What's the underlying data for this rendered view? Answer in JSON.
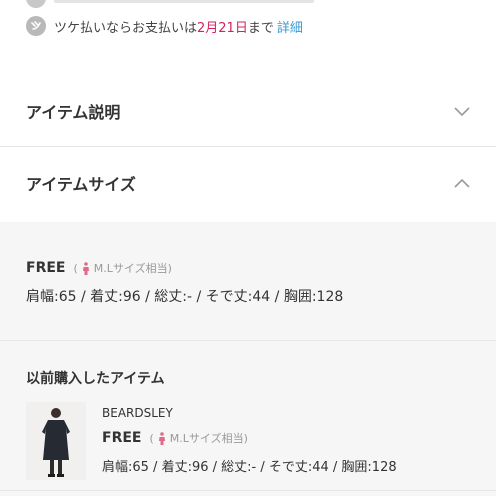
{
  "payment": {
    "text_before": "ツケ払いならお支払いは",
    "date": "2月21日",
    "text_after": "まで",
    "link": "詳細",
    "icon": "tsuke-payment-icon"
  },
  "sections": {
    "description": {
      "title": "アイテム説明",
      "chevron": "chevron-down"
    },
    "size": {
      "title": "アイテムサイズ",
      "chevron": "chevron-up"
    }
  },
  "size_info": {
    "size": "FREE",
    "equiv_open": "(",
    "equiv_label": "M.Lサイズ相当)",
    "measurements": "肩幅:65 / 着丈:96 / 総丈:- / そで丈:44 / 胸囲:128"
  },
  "previous": {
    "title": "以前購入したアイテム",
    "item": {
      "brand": "BEARDSLEY",
      "size": "FREE",
      "equiv_open": "(",
      "equiv_label": "M.Lサイズ相当)",
      "measurements": "肩幅:65 / 着丈:96 / 総丈:- / そで丈:44 / 胸囲:128"
    }
  },
  "colors": {
    "accent_date": "#d4225c",
    "link": "#3a9bd5",
    "person_icon": "#e06a8a",
    "size_bg": "#f6f6f6"
  }
}
